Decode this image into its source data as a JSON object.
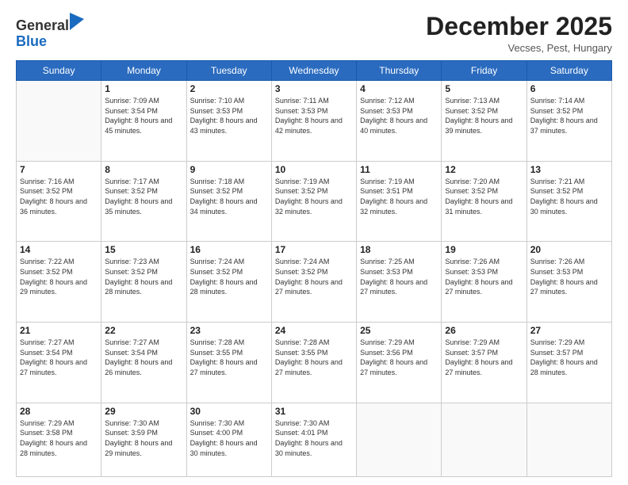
{
  "logo": {
    "general": "General",
    "blue": "Blue"
  },
  "header": {
    "month": "December 2025",
    "location": "Vecses, Pest, Hungary"
  },
  "days_header": [
    "Sunday",
    "Monday",
    "Tuesday",
    "Wednesday",
    "Thursday",
    "Friday",
    "Saturday"
  ],
  "weeks": [
    [
      {
        "day": "",
        "sunrise": "",
        "sunset": "",
        "daylight": ""
      },
      {
        "day": "1",
        "sunrise": "Sunrise: 7:09 AM",
        "sunset": "Sunset: 3:54 PM",
        "daylight": "Daylight: 8 hours and 45 minutes."
      },
      {
        "day": "2",
        "sunrise": "Sunrise: 7:10 AM",
        "sunset": "Sunset: 3:53 PM",
        "daylight": "Daylight: 8 hours and 43 minutes."
      },
      {
        "day": "3",
        "sunrise": "Sunrise: 7:11 AM",
        "sunset": "Sunset: 3:53 PM",
        "daylight": "Daylight: 8 hours and 42 minutes."
      },
      {
        "day": "4",
        "sunrise": "Sunrise: 7:12 AM",
        "sunset": "Sunset: 3:53 PM",
        "daylight": "Daylight: 8 hours and 40 minutes."
      },
      {
        "day": "5",
        "sunrise": "Sunrise: 7:13 AM",
        "sunset": "Sunset: 3:52 PM",
        "daylight": "Daylight: 8 hours and 39 minutes."
      },
      {
        "day": "6",
        "sunrise": "Sunrise: 7:14 AM",
        "sunset": "Sunset: 3:52 PM",
        "daylight": "Daylight: 8 hours and 37 minutes."
      }
    ],
    [
      {
        "day": "7",
        "sunrise": "Sunrise: 7:16 AM",
        "sunset": "Sunset: 3:52 PM",
        "daylight": "Daylight: 8 hours and 36 minutes."
      },
      {
        "day": "8",
        "sunrise": "Sunrise: 7:17 AM",
        "sunset": "Sunset: 3:52 PM",
        "daylight": "Daylight: 8 hours and 35 minutes."
      },
      {
        "day": "9",
        "sunrise": "Sunrise: 7:18 AM",
        "sunset": "Sunset: 3:52 PM",
        "daylight": "Daylight: 8 hours and 34 minutes."
      },
      {
        "day": "10",
        "sunrise": "Sunrise: 7:19 AM",
        "sunset": "Sunset: 3:52 PM",
        "daylight": "Daylight: 8 hours and 32 minutes."
      },
      {
        "day": "11",
        "sunrise": "Sunrise: 7:19 AM",
        "sunset": "Sunset: 3:51 PM",
        "daylight": "Daylight: 8 hours and 32 minutes."
      },
      {
        "day": "12",
        "sunrise": "Sunrise: 7:20 AM",
        "sunset": "Sunset: 3:52 PM",
        "daylight": "Daylight: 8 hours and 31 minutes."
      },
      {
        "day": "13",
        "sunrise": "Sunrise: 7:21 AM",
        "sunset": "Sunset: 3:52 PM",
        "daylight": "Daylight: 8 hours and 30 minutes."
      }
    ],
    [
      {
        "day": "14",
        "sunrise": "Sunrise: 7:22 AM",
        "sunset": "Sunset: 3:52 PM",
        "daylight": "Daylight: 8 hours and 29 minutes."
      },
      {
        "day": "15",
        "sunrise": "Sunrise: 7:23 AM",
        "sunset": "Sunset: 3:52 PM",
        "daylight": "Daylight: 8 hours and 28 minutes."
      },
      {
        "day": "16",
        "sunrise": "Sunrise: 7:24 AM",
        "sunset": "Sunset: 3:52 PM",
        "daylight": "Daylight: 8 hours and 28 minutes."
      },
      {
        "day": "17",
        "sunrise": "Sunrise: 7:24 AM",
        "sunset": "Sunset: 3:52 PM",
        "daylight": "Daylight: 8 hours and 27 minutes."
      },
      {
        "day": "18",
        "sunrise": "Sunrise: 7:25 AM",
        "sunset": "Sunset: 3:53 PM",
        "daylight": "Daylight: 8 hours and 27 minutes."
      },
      {
        "day": "19",
        "sunrise": "Sunrise: 7:26 AM",
        "sunset": "Sunset: 3:53 PM",
        "daylight": "Daylight: 8 hours and 27 minutes."
      },
      {
        "day": "20",
        "sunrise": "Sunrise: 7:26 AM",
        "sunset": "Sunset: 3:53 PM",
        "daylight": "Daylight: 8 hours and 27 minutes."
      }
    ],
    [
      {
        "day": "21",
        "sunrise": "Sunrise: 7:27 AM",
        "sunset": "Sunset: 3:54 PM",
        "daylight": "Daylight: 8 hours and 27 minutes."
      },
      {
        "day": "22",
        "sunrise": "Sunrise: 7:27 AM",
        "sunset": "Sunset: 3:54 PM",
        "daylight": "Daylight: 8 hours and 26 minutes."
      },
      {
        "day": "23",
        "sunrise": "Sunrise: 7:28 AM",
        "sunset": "Sunset: 3:55 PM",
        "daylight": "Daylight: 8 hours and 27 minutes."
      },
      {
        "day": "24",
        "sunrise": "Sunrise: 7:28 AM",
        "sunset": "Sunset: 3:55 PM",
        "daylight": "Daylight: 8 hours and 27 minutes."
      },
      {
        "day": "25",
        "sunrise": "Sunrise: 7:29 AM",
        "sunset": "Sunset: 3:56 PM",
        "daylight": "Daylight: 8 hours and 27 minutes."
      },
      {
        "day": "26",
        "sunrise": "Sunrise: 7:29 AM",
        "sunset": "Sunset: 3:57 PM",
        "daylight": "Daylight: 8 hours and 27 minutes."
      },
      {
        "day": "27",
        "sunrise": "Sunrise: 7:29 AM",
        "sunset": "Sunset: 3:57 PM",
        "daylight": "Daylight: 8 hours and 28 minutes."
      }
    ],
    [
      {
        "day": "28",
        "sunrise": "Sunrise: 7:29 AM",
        "sunset": "Sunset: 3:58 PM",
        "daylight": "Daylight: 8 hours and 28 minutes."
      },
      {
        "day": "29",
        "sunrise": "Sunrise: 7:30 AM",
        "sunset": "Sunset: 3:59 PM",
        "daylight": "Daylight: 8 hours and 29 minutes."
      },
      {
        "day": "30",
        "sunrise": "Sunrise: 7:30 AM",
        "sunset": "Sunset: 4:00 PM",
        "daylight": "Daylight: 8 hours and 30 minutes."
      },
      {
        "day": "31",
        "sunrise": "Sunrise: 7:30 AM",
        "sunset": "Sunset: 4:01 PM",
        "daylight": "Daylight: 8 hours and 30 minutes."
      },
      {
        "day": "",
        "sunrise": "",
        "sunset": "",
        "daylight": ""
      },
      {
        "day": "",
        "sunrise": "",
        "sunset": "",
        "daylight": ""
      },
      {
        "day": "",
        "sunrise": "",
        "sunset": "",
        "daylight": ""
      }
    ]
  ]
}
